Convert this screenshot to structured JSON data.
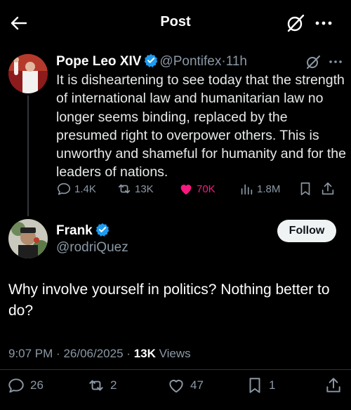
{
  "header": {
    "title": "Post",
    "back_icon": "arrow-left-icon",
    "grok_icon": "grok-icon",
    "more_icon": "more-horizontal-icon"
  },
  "quoted_post": {
    "author_name": "Pope Leo XIV",
    "handle": "@Pontifex",
    "separator": "·",
    "time": "11h",
    "text": "It is disheartening to see today that the strength of international law and humanitarian law no longer seems binding, replaced by the presumed right to overpower others. This is unworthy and shameful for humanity and for the leaders of nations.",
    "stats": {
      "replies": "1.4K",
      "reposts": "13K",
      "likes": "70K",
      "views": "1.8M"
    },
    "like_color": "#f91880",
    "verified_color": "#1d9bf0"
  },
  "reply": {
    "author_name": "Frank",
    "handle": "@rodriQuez",
    "follow_label": "Follow",
    "text": "Why involve yourself in politics? Nothing better to do?",
    "time": "9:07 PM",
    "date": "26/06/2025",
    "views_count": "13K",
    "views_label": "Views",
    "separator": "·",
    "stats": {
      "replies": "26",
      "reposts": "2",
      "likes": "47",
      "bookmarks": "1"
    }
  }
}
